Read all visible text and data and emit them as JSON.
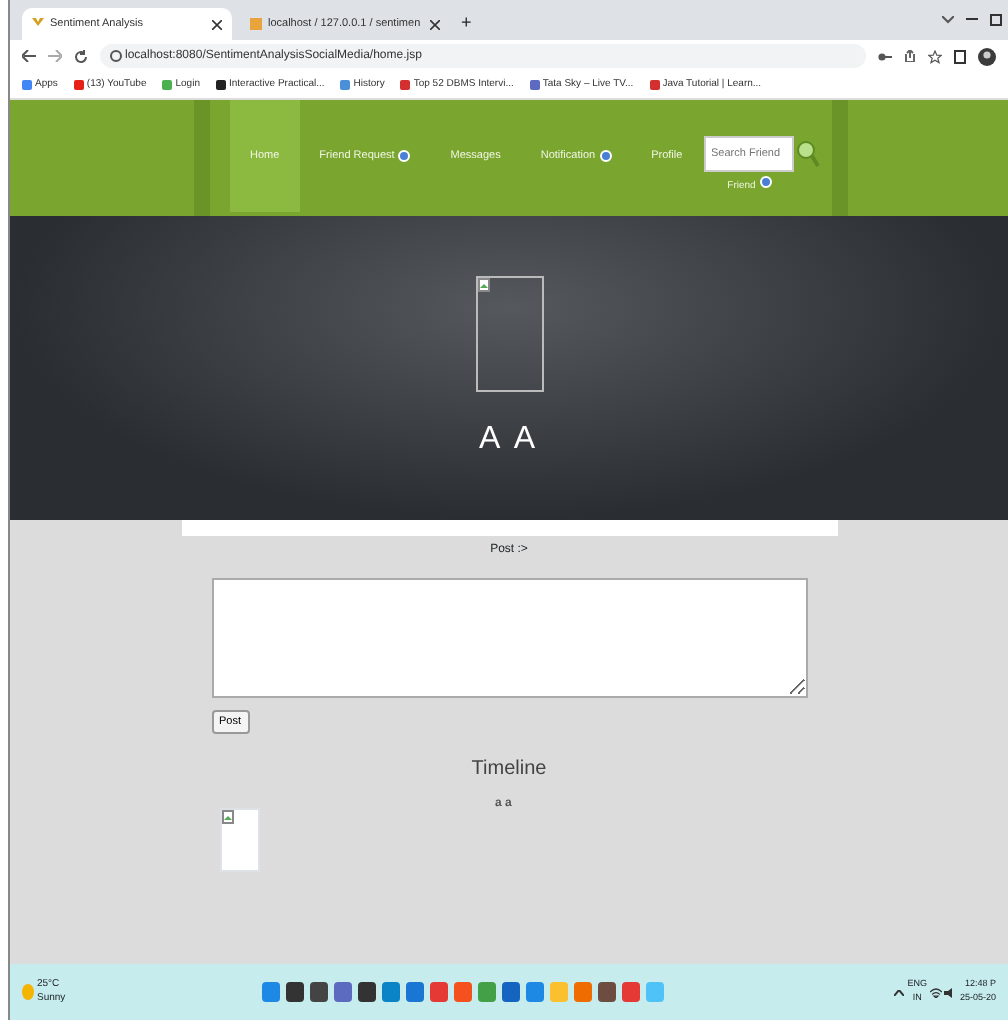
{
  "browser": {
    "tabs": [
      {
        "title": "Sentiment Analysis",
        "selected": true
      },
      {
        "title": "localhost / 127.0.0.1 / sentimen",
        "selected": false
      }
    ],
    "new_tab": "+",
    "address": "localhost:8080/SentimentAnalysisSocialMedia/home.jsp",
    "bookmarks": [
      "Apps",
      "(13) YouTube",
      "Login",
      "Interactive Practical...",
      "History",
      "Top 52 DBMS Intervi...",
      "Tata Sky – Live TV...",
      "Java Tutorial | Learn..."
    ]
  },
  "nav": {
    "items": [
      {
        "label": "Home",
        "selected": true,
        "badge": false
      },
      {
        "label": "Friend Request",
        "selected": false,
        "badge": true
      },
      {
        "label": "Messages",
        "selected": false,
        "badge": false
      },
      {
        "label": "Notification",
        "selected": false,
        "badge": true
      },
      {
        "label": "Profile",
        "selected": false,
        "badge": false
      }
    ],
    "search": {
      "placeholder": "Search Friend"
    },
    "friend_label": "Friend"
  },
  "profile": {
    "name": "A A"
  },
  "post": {
    "label": "Post :>",
    "button": "Post"
  },
  "timeline": {
    "title": "Timeline",
    "entries": [
      {
        "author": "a a"
      }
    ]
  },
  "taskbar": {
    "weather": "25°C",
    "condition": "Sunny",
    "lang": "ENG",
    "region": "IN",
    "time": "12:48 P",
    "date": "25-05-20"
  }
}
